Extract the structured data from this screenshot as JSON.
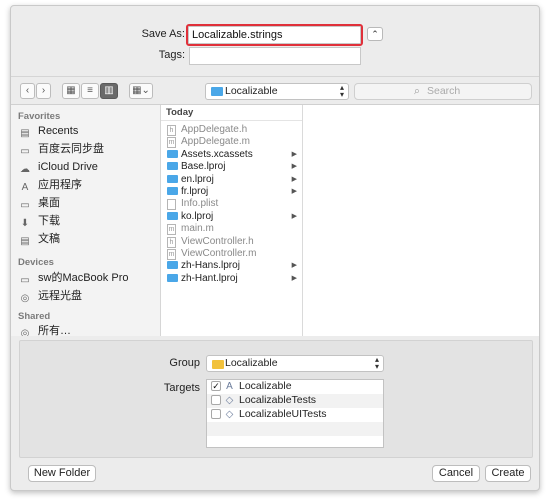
{
  "save_as": {
    "label": "Save As:",
    "value": "Localizable.strings"
  },
  "tags": {
    "label": "Tags:",
    "value": ""
  },
  "expand_glyph": "⌃",
  "toolbar": {
    "back": "‹",
    "forward": "›",
    "location": "Localizable",
    "search_placeholder": "Search"
  },
  "sidebar": {
    "favorites_title": "Favorites",
    "favorites": [
      {
        "label": "Recents",
        "icon": "recents-icon",
        "glyph": "▤"
      },
      {
        "label": "百度云同步盘",
        "icon": "folder-icon",
        "glyph": "▭"
      },
      {
        "label": "iCloud Drive",
        "icon": "cloud-icon",
        "glyph": "☁"
      },
      {
        "label": "应用程序",
        "icon": "applications-icon",
        "glyph": "A"
      },
      {
        "label": "桌面",
        "icon": "desktop-icon",
        "glyph": "▭"
      },
      {
        "label": "下载",
        "icon": "downloads-icon",
        "glyph": "⬇"
      },
      {
        "label": "文稿",
        "icon": "documents-icon",
        "glyph": "▤"
      }
    ],
    "devices_title": "Devices",
    "devices": [
      {
        "label": "sw的MacBook Pro",
        "icon": "laptop-icon",
        "glyph": "▭"
      },
      {
        "label": "远程光盘",
        "icon": "disc-icon",
        "glyph": "◎"
      }
    ],
    "shared_title": "Shared",
    "shared": [
      {
        "label": "所有…",
        "icon": "network-icon",
        "glyph": "◎"
      }
    ]
  },
  "column": {
    "header": "Today",
    "files": [
      {
        "name": "AppDelegate.h",
        "kind": "doc",
        "badge": "h",
        "dim": true,
        "folder": false
      },
      {
        "name": "AppDelegate.m",
        "kind": "doc",
        "badge": "m",
        "dim": true,
        "folder": false
      },
      {
        "name": "Assets.xcassets",
        "kind": "folder",
        "dim": false,
        "folder": true
      },
      {
        "name": "Base.lproj",
        "kind": "folder",
        "dim": false,
        "folder": true
      },
      {
        "name": "en.lproj",
        "kind": "folder",
        "dim": false,
        "folder": true
      },
      {
        "name": "fr.lproj",
        "kind": "folder",
        "dim": false,
        "folder": true
      },
      {
        "name": "Info.plist",
        "kind": "doc",
        "badge": "",
        "dim": true,
        "folder": false
      },
      {
        "name": "ko.lproj",
        "kind": "folder",
        "dim": false,
        "folder": true
      },
      {
        "name": "main.m",
        "kind": "doc",
        "badge": "m",
        "dim": true,
        "folder": false
      },
      {
        "name": "ViewController.h",
        "kind": "doc",
        "badge": "h",
        "dim": true,
        "folder": false
      },
      {
        "name": "ViewController.m",
        "kind": "doc",
        "badge": "m",
        "dim": true,
        "folder": false
      },
      {
        "name": "zh-Hans.lproj",
        "kind": "folder",
        "dim": false,
        "folder": true
      },
      {
        "name": "zh-Hant.lproj",
        "kind": "folder",
        "dim": false,
        "folder": true
      }
    ]
  },
  "options": {
    "group_label": "Group",
    "group_value": "Localizable",
    "targets_label": "Targets",
    "targets": [
      {
        "name": "Localizable",
        "checked": true
      },
      {
        "name": "LocalizableTests",
        "checked": false
      },
      {
        "name": "LocalizableUITests",
        "checked": false
      }
    ]
  },
  "buttons": {
    "new_folder": "New Folder",
    "cancel": "Cancel",
    "create": "Create"
  },
  "colors": {
    "highlight": "#e0303a",
    "folder_blue": "#4aa7e8",
    "folder_yellow": "#f2c23c"
  }
}
